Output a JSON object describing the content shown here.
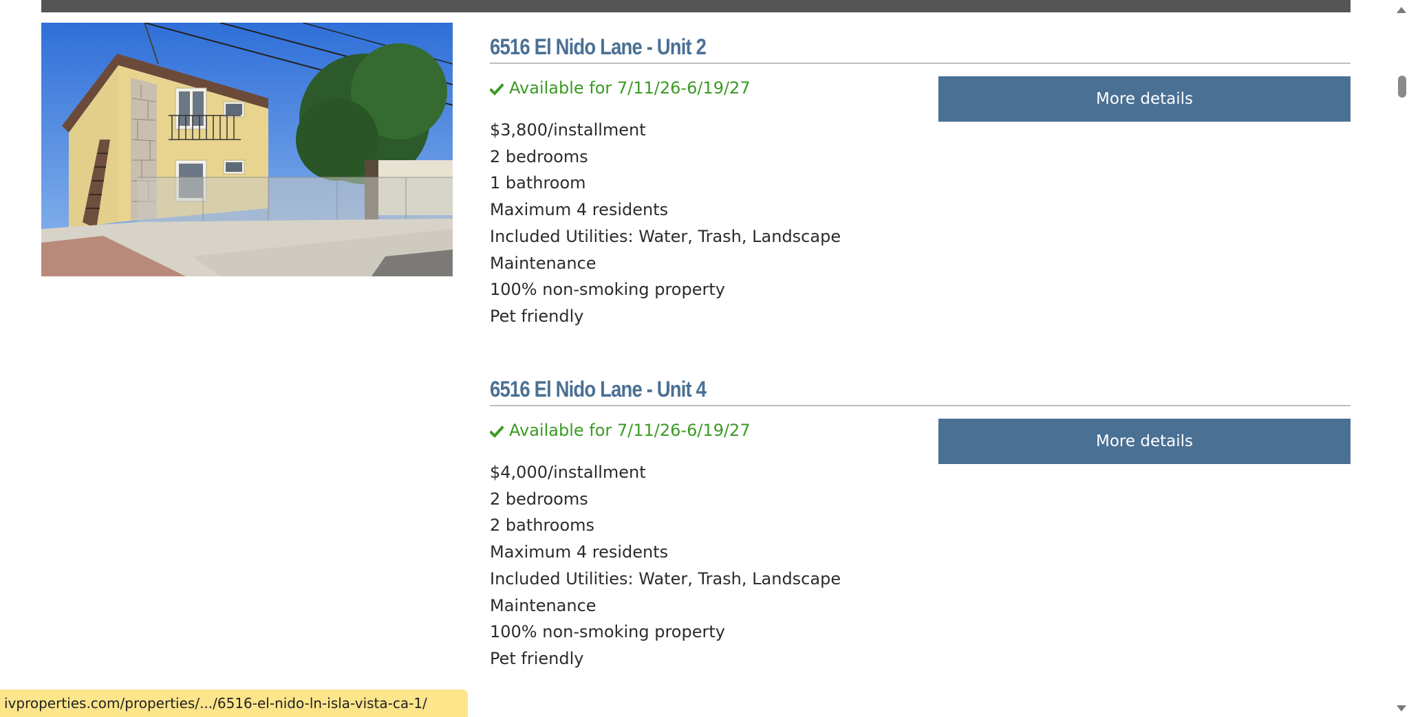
{
  "listings": [
    {
      "title": "6516 El Nido Lane - Unit 2",
      "availability": "Available for 7/11/26-6/19/27",
      "details": [
        "$3,800/installment",
        "2 bedrooms",
        "1 bathroom",
        "Maximum 4 residents",
        "Included Utilities: Water, Trash, Landscape",
        "Maintenance",
        "100% non-smoking property",
        "Pet friendly"
      ],
      "button_label": "More details"
    },
    {
      "title": "6516 El Nido Lane - Unit 4",
      "availability": "Available for 7/11/26-6/19/27",
      "details": [
        "$4,000/installment",
        "2 bedrooms",
        "2 bathrooms",
        "Maximum 4 residents",
        "Included Utilities: Water, Trash, Landscape",
        "Maintenance",
        "100% non-smoking property",
        "Pet friendly"
      ],
      "button_label": "More details"
    }
  ],
  "status_bar": {
    "url": "ivproperties.com/properties/.../6516-el-nido-ln-isla-vista-ca-1/"
  },
  "icons": {
    "availability": "check-icon",
    "scroll_up": "chevron-up-icon",
    "scroll_down": "chevron-down-icon"
  },
  "colors": {
    "title": "#4a7094",
    "button": "#4a7094",
    "available": "#3a9a22",
    "status_bar": "#fce58a",
    "top_bar": "#555555"
  }
}
